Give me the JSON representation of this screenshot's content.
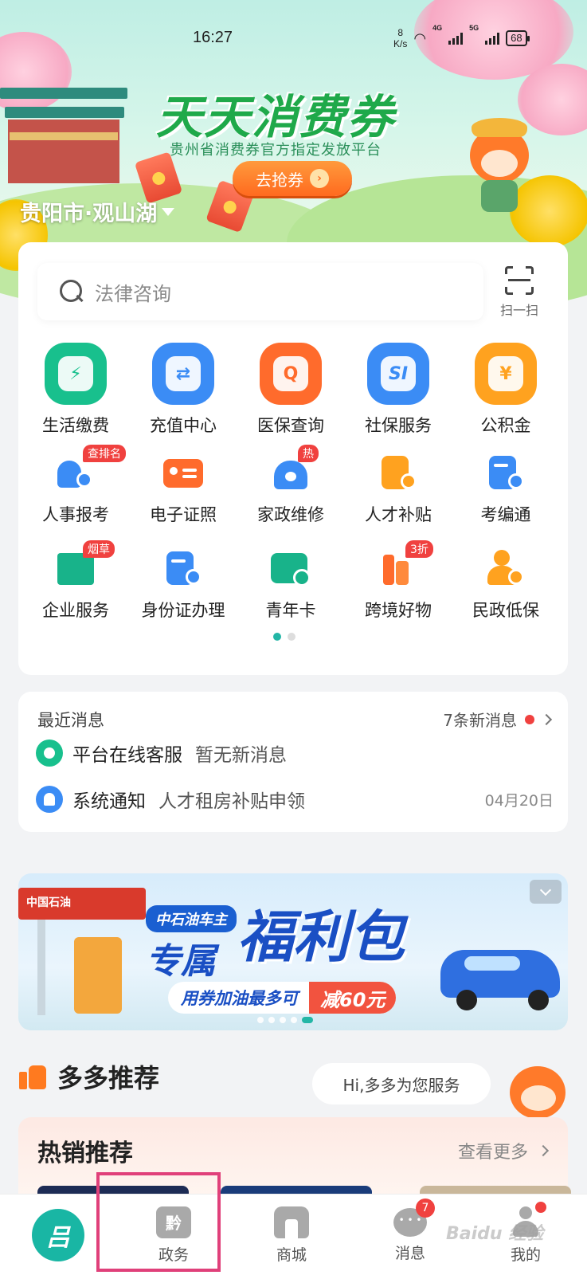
{
  "status_bar": {
    "time": "16:27",
    "net_speed_value": "8",
    "net_speed_unit": "K/s",
    "signal_1": "4G",
    "signal_2": "5G",
    "battery": "68"
  },
  "hero": {
    "title": "天天消费券",
    "subtitle": "贵州省消费券官方指定发放平台",
    "cta_label": "去抢券",
    "location": "贵阳市·观山湖"
  },
  "search": {
    "placeholder": "法律咨询",
    "scan_label": "扫一扫"
  },
  "services_row1": [
    {
      "label": "生活缴费",
      "color": "#18c08d",
      "glyph": "⚡"
    },
    {
      "label": "充值中心",
      "color": "#3b8cf5",
      "glyph": "⇄"
    },
    {
      "label": "医保查询",
      "color": "#ff6b2c",
      "glyph": "Q"
    },
    {
      "label": "社保服务",
      "color": "#3b8cf5",
      "glyph": "SI"
    },
    {
      "label": "公积金",
      "color": "#ffa21f",
      "glyph": "¥"
    }
  ],
  "services_row2": [
    {
      "label": "人事报考",
      "tag": "查排名",
      "color": "#3b8cf5"
    },
    {
      "label": "电子证照",
      "tag": "",
      "color": "#ff6b2c"
    },
    {
      "label": "家政维修",
      "tag": "热",
      "color": "#3b8cf5"
    },
    {
      "label": "人才补贴",
      "tag": "",
      "color": "#ffa21f"
    },
    {
      "label": "考编通",
      "tag": "",
      "color": "#3b8cf5"
    }
  ],
  "services_row3": [
    {
      "label": "企业服务",
      "tag": "烟草",
      "color": "#18b38a"
    },
    {
      "label": "身份证办理",
      "tag": "",
      "color": "#3b8cf5"
    },
    {
      "label": "青年卡",
      "tag": "",
      "color": "#18b38a"
    },
    {
      "label": "跨境好物",
      "tag": "3折",
      "color": "#ff6b2c"
    },
    {
      "label": "民政低保",
      "tag": "",
      "color": "#ffa21f"
    }
  ],
  "messages": {
    "title": "最近消息",
    "new_count": "7条新消息",
    "items": [
      {
        "name": "平台在线客服",
        "text": "暂无新消息",
        "date": ""
      },
      {
        "name": "系统通知",
        "text": "人才租房补贴申领",
        "date": "04月20日"
      }
    ]
  },
  "banner": {
    "brand": "中国石油",
    "badge": "中石油车主",
    "line1": "专属",
    "line2": "福利包",
    "sub": "用券加油最多可",
    "discount": "减60元"
  },
  "recommend": {
    "title": "多多推荐",
    "bubble": "Hi,多多为您服务",
    "hot_title": "热销推荐",
    "more": "查看更多"
  },
  "tabbar": {
    "logo_glyph": "吕",
    "gov_glyph": "黔",
    "tab_gov": "政务",
    "tab_mall": "商城",
    "tab_msg": "消息",
    "msg_badge": "7",
    "tab_me": "我的"
  },
  "watermark": "Baidu 经验"
}
